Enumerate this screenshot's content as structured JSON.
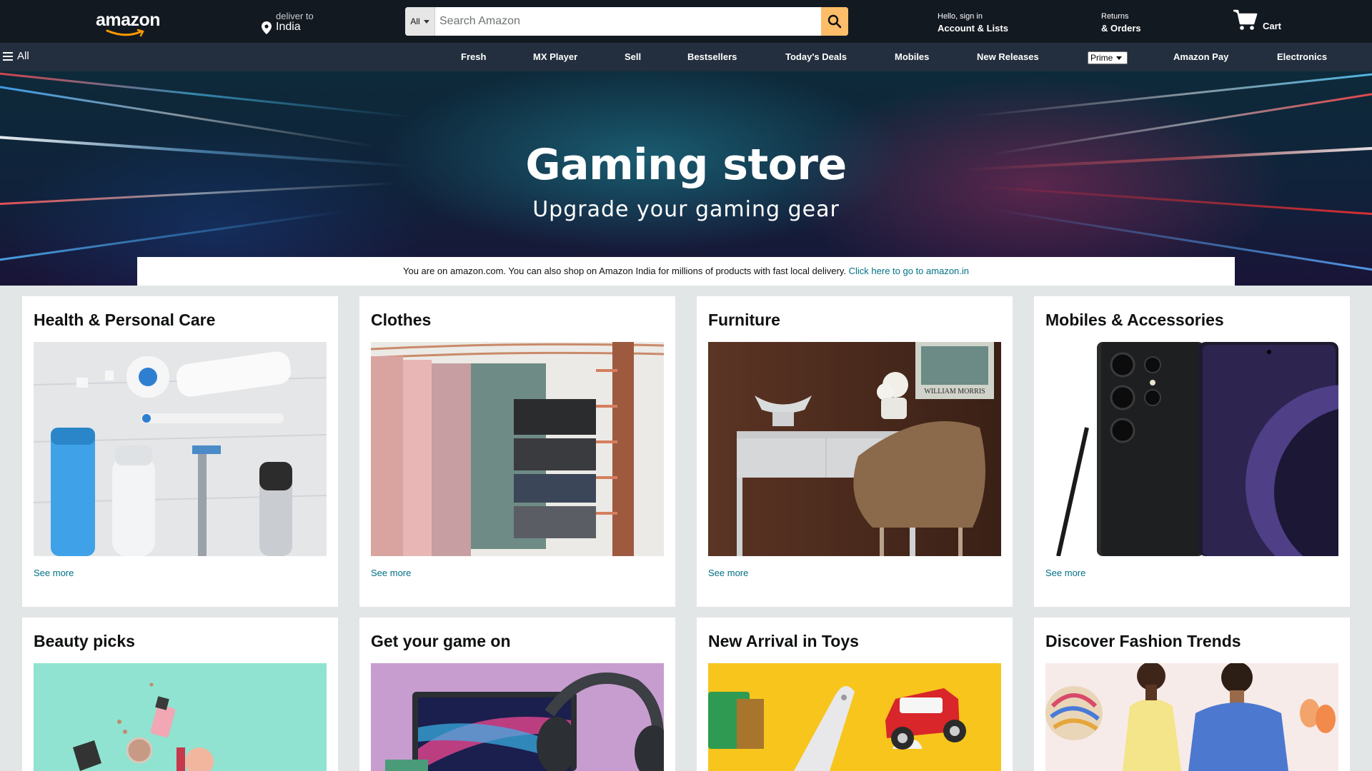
{
  "header": {
    "logo_text": "amazon",
    "deliver_line1": "deliver to",
    "deliver_line2": "India",
    "search_category": "All",
    "search_placeholder": "Search Amazon",
    "account_line1": "Hello, sign in",
    "account_line2": "Account & Lists",
    "orders_line1": "Returns",
    "orders_line2": "& Orders",
    "cart_label": "Cart"
  },
  "nav": {
    "all_label": "All",
    "items": [
      "Fresh",
      "MX Player",
      "Sell",
      "Bestsellers",
      "Today's Deals",
      "Mobiles",
      "New Releases",
      "Amazon Pay",
      "Electronics"
    ],
    "prime_select": "Prime"
  },
  "hero": {
    "title": "Gaming store",
    "subtitle": "Upgrade your gaming gear"
  },
  "notice": {
    "text": "You are on amazon.com. You can also shop on Amazon India for millions of products with fast local delivery.",
    "link": "Click here to go to amazon.in"
  },
  "cards": [
    {
      "title": "Health & Personal Care",
      "link": "See more"
    },
    {
      "title": "Clothes",
      "link": "See more"
    },
    {
      "title": "Furniture",
      "link": "See more"
    },
    {
      "title": "Mobiles & Accessories",
      "link": "See more"
    },
    {
      "title": "Beauty picks"
    },
    {
      "title": "Get your game on"
    },
    {
      "title": "New Arrival in Toys"
    },
    {
      "title": "Discover Fashion Trends"
    }
  ],
  "image_texts": {
    "furniture_poster": "WILLIAM  MORRIS"
  },
  "colors": {
    "header_bg": "#131921",
    "nav_bg": "#232f3e",
    "search_button": "#febd69",
    "link": "#007185",
    "page_bg": "#e3e6e6"
  }
}
